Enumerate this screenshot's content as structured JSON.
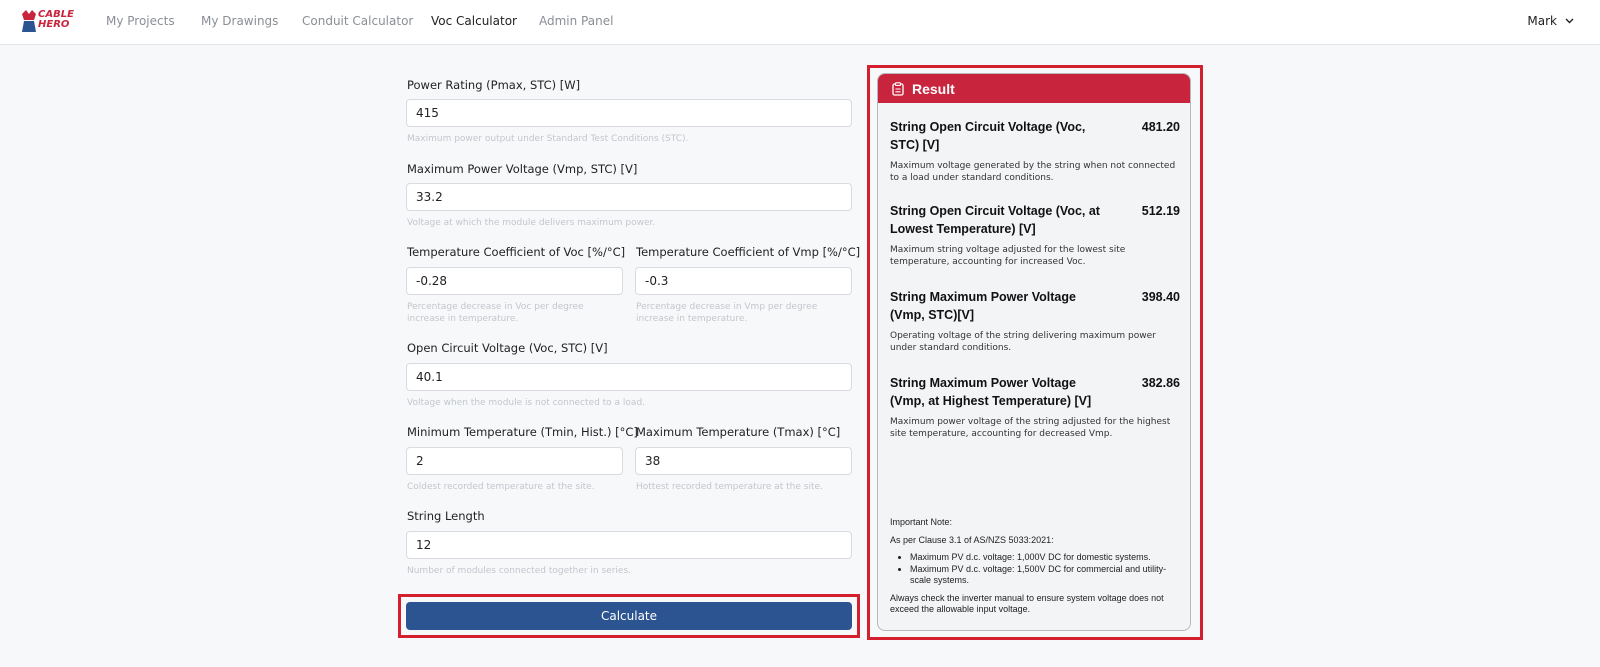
{
  "nav": {
    "logo_line1": "CABLE",
    "logo_line2": "HERO",
    "links": [
      "My Projects",
      "My Drawings",
      "Conduit Calculator",
      "Voc Calculator",
      "Admin Panel"
    ],
    "active": "Voc Calculator",
    "user": "Mark"
  },
  "form": {
    "power_rating": {
      "label": "Power Rating (Pmax, STC) [W]",
      "value": "415",
      "help": "Maximum power output under Standard Test Conditions (STC)."
    },
    "vmp": {
      "label": "Maximum Power Voltage (Vmp, STC) [V]",
      "value": "33.2",
      "help": "Voltage at which the module delivers maximum power."
    },
    "temp_coef_voc": {
      "label": "Temperature Coefficient of Voc [%/°C]",
      "value": "-0.28",
      "help": "Percentage decrease in Voc per degree increase in temperature."
    },
    "temp_coef_vmp": {
      "label": "Temperature Coefficient of Vmp [%/°C]",
      "value": "-0.3",
      "help": "Percentage decrease in Vmp per degree increase in temperature."
    },
    "voc": {
      "label": "Open Circuit Voltage (Voc, STC) [V]",
      "value": "40.1",
      "help": "Voltage when the module is not connected to a load."
    },
    "tmin": {
      "label": "Minimum Temperature (Tmin, Hist.) [°C]",
      "value": "2",
      "help": "Coldest recorded temperature at the site."
    },
    "tmax": {
      "label": "Maximum Temperature (Tmax) [°C]",
      "value": "38",
      "help": "Hottest recorded temperature at the site."
    },
    "string_length": {
      "label": "String Length",
      "value": "12",
      "help": "Number of modules connected together in series."
    },
    "calculate_label": "Calculate"
  },
  "result": {
    "header": "Result",
    "items": [
      {
        "title": "String Open Circuit Voltage (Voc, STC) [V]",
        "value": "481.20",
        "desc": "Maximum voltage generated by the string when not connected to a load under standard conditions."
      },
      {
        "title": "String Open Circuit Voltage (Voc, at Lowest Temperature) [V]",
        "value": "512.19",
        "desc": "Maximum string voltage adjusted for the lowest site temperature, accounting for increased Voc."
      },
      {
        "title": "String Maximum Power Voltage (Vmp, STC)[V]",
        "value": "398.40",
        "desc": "Operating voltage of the string delivering maximum power under standard conditions."
      },
      {
        "title": "String Maximum Power Voltage (Vmp, at Highest Temperature) [V]",
        "value": "382.86",
        "desc": "Maximum power voltage of the string adjusted for the highest site temperature, accounting for decreased Vmp."
      }
    ],
    "note": {
      "heading": "Important Note:",
      "clause": "As per Clause 3.1 of AS/NZS 5033:2021:",
      "bullets": [
        "Maximum PV d.c. voltage: 1,000V DC for domestic systems.",
        "Maximum PV d.c. voltage: 1,500V DC for commercial and utility-scale systems."
      ],
      "footer": "Always check the inverter manual to ensure system voltage does not exceed the allowable input voltage."
    }
  },
  "colors": {
    "brand_red": "#c8243d",
    "button_blue": "#2c5490",
    "highlight_red": "#d4202e"
  }
}
